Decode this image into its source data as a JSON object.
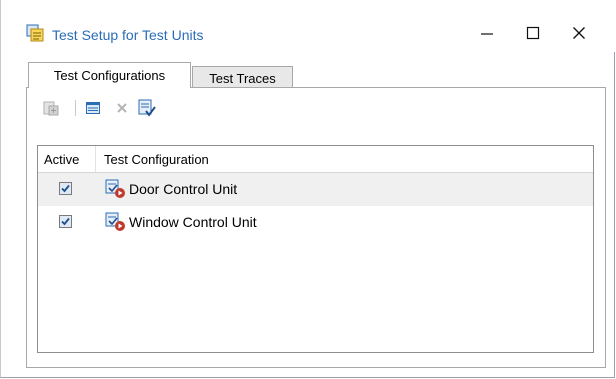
{
  "window": {
    "title": "Test Setup for Test Units",
    "icon": "test-setup-icon",
    "controls": {
      "minimize": "minimize-icon",
      "maximize": "maximize-icon",
      "close": "close-icon"
    }
  },
  "tabs": [
    {
      "label": "Test Configurations",
      "active": true
    },
    {
      "label": "Test Traces",
      "active": false
    }
  ],
  "toolbar": {
    "buttons": [
      {
        "name": "add-configuration",
        "icon": "add-config-icon",
        "enabled": false
      },
      {
        "name": "open-configuration",
        "icon": "folder-icon",
        "enabled": true
      },
      {
        "name": "delete-configuration",
        "icon": "delete-icon",
        "enabled": false
      },
      {
        "name": "check-configuration",
        "icon": "checklist-icon",
        "enabled": true
      }
    ]
  },
  "list": {
    "columns": [
      "Active",
      "Test Configuration"
    ],
    "rows": [
      {
        "active": true,
        "name": "Door Control Unit",
        "icon": "test-unit-icon"
      },
      {
        "active": true,
        "name": "Window Control Unit",
        "icon": "test-unit-icon"
      }
    ]
  },
  "colors": {
    "title": "#2b6db5",
    "accent": "#c0392b"
  }
}
